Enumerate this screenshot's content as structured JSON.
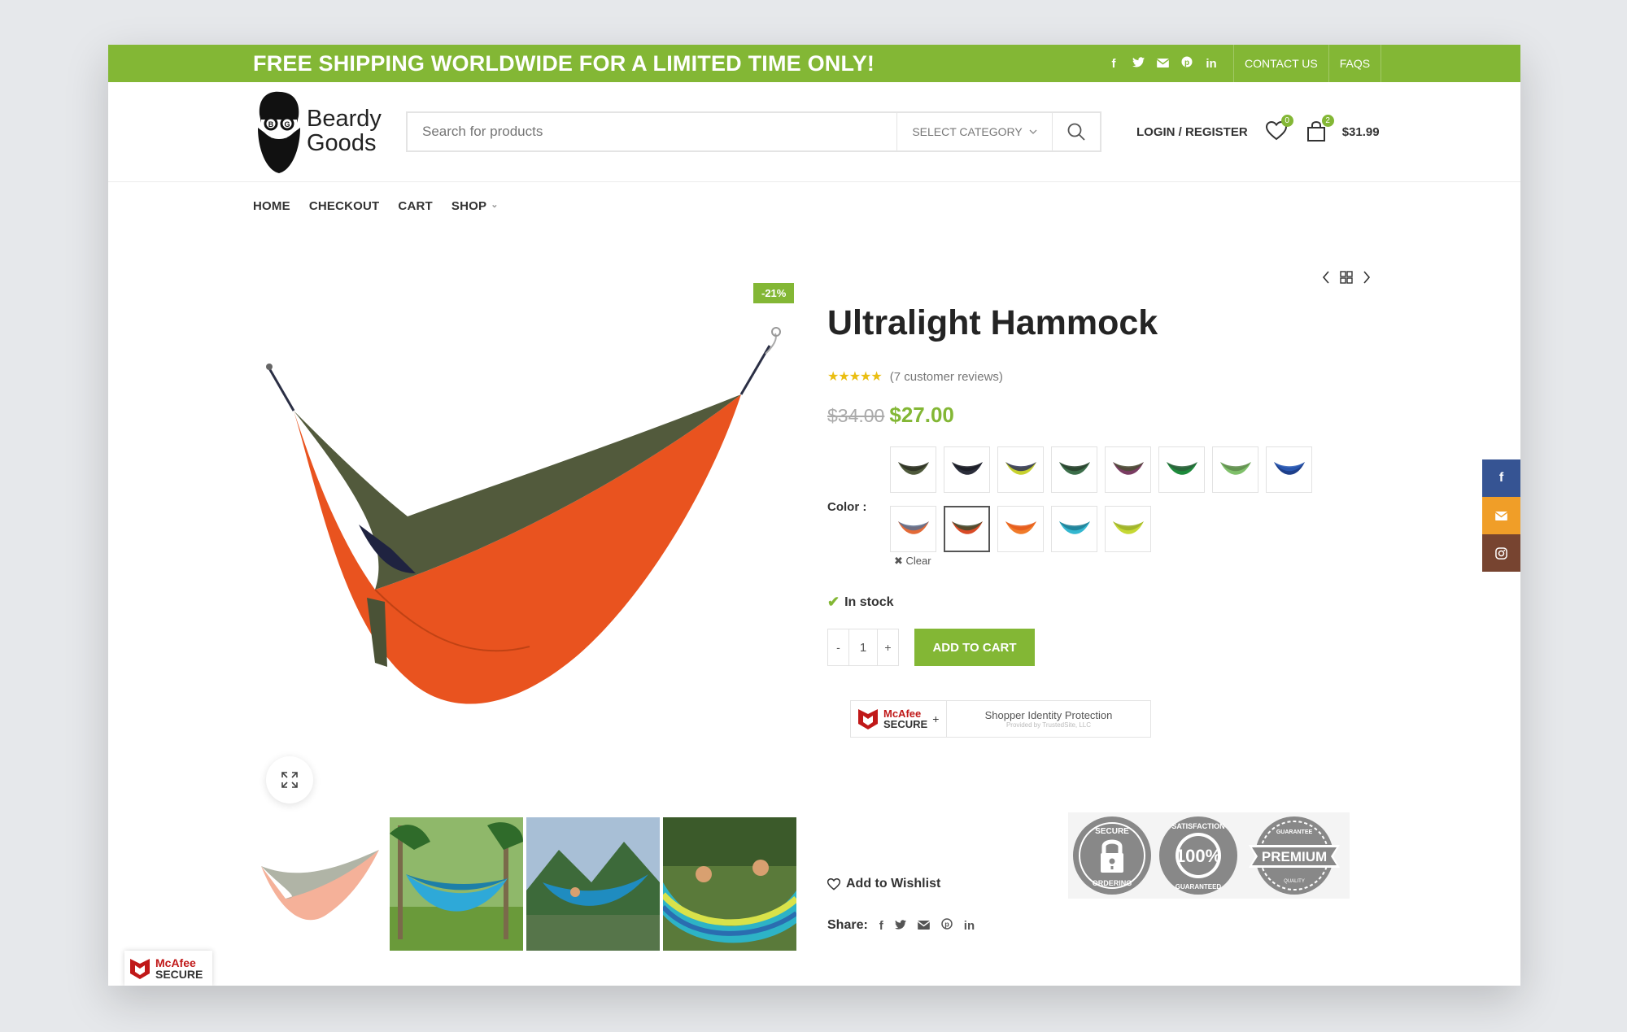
{
  "topbar": {
    "promo": "FREE SHIPPING WORLDWIDE FOR A LIMITED TIME ONLY!",
    "social_icons": [
      "facebook-icon",
      "twitter-icon",
      "email-icon",
      "pinterest-icon",
      "linkedin-icon"
    ],
    "links": [
      "CONTACT US",
      "FAQS"
    ],
    "background": "#83b735"
  },
  "header": {
    "logo_line1": "Beardy",
    "logo_line2": "Goods",
    "search_placeholder": "Search for products",
    "category_label": "SELECT CATEGORY",
    "login_label": "LOGIN / REGISTER",
    "wishlist_count": "0",
    "cart_count": "2",
    "cart_total": "$31.99"
  },
  "nav": [
    "HOME",
    "CHECKOUT",
    "CART",
    "SHOP"
  ],
  "product": {
    "sale_badge": "-21%",
    "title": "Ultralight Hammock",
    "rating_stars": 5,
    "reviews": "(7 customer reviews)",
    "old_price": "$34.00",
    "new_price": "$27.00",
    "color_label": "Color :",
    "swatches": [
      {
        "a": "#4f5a3c",
        "b": "#2c2f22"
      },
      {
        "a": "#2b2d3a",
        "b": "#1a1c24"
      },
      {
        "a": "#c7d12e",
        "b": "#2e3358"
      },
      {
        "a": "#3c6e4a",
        "b": "#27402c"
      },
      {
        "a": "#7a3c62",
        "b": "#4b4e35"
      },
      {
        "a": "#1d8a3b",
        "b": "#2a5f3a"
      },
      {
        "a": "#7fc06a",
        "b": "#5f8c4c"
      },
      {
        "a": "#1e3f8a",
        "b": "#2a5bb5"
      },
      {
        "a": "#e36a37",
        "b": "#5a6f8f"
      },
      {
        "a": "#d94b27",
        "b": "#3f4a2e"
      },
      {
        "a": "#f07b2a",
        "b": "#e55a1c"
      },
      {
        "a": "#33b7d0",
        "b": "#1f7e94"
      },
      {
        "a": "#c6d834",
        "b": "#9bb02a"
      }
    ],
    "selected_swatch": 9,
    "clear_label": "Clear",
    "stock": "In stock",
    "quantity": "1",
    "add_to_cart": "ADD TO CART",
    "mcafee_brand": "McAfee",
    "mcafee_secure": "SECURE",
    "mcafee_line1": "Shopper Identity Protection",
    "mcafee_line2": "Provided by TrustedSite, LLC",
    "trust_badges": [
      "SECURE ORDERING",
      "100% SATISFACTION GUARANTEED",
      "PREMIUM"
    ],
    "wishlist_label": "Add to Wishlist",
    "share_label": "Share:",
    "share_icons": [
      "facebook-icon",
      "twitter-icon",
      "email-icon",
      "pinterest-icon",
      "linkedin-icon"
    ]
  },
  "colors": {
    "accent": "#83b735",
    "star": "#eabe12",
    "facebook": "#365493",
    "email": "#f09e28",
    "instagram": "#774430"
  }
}
